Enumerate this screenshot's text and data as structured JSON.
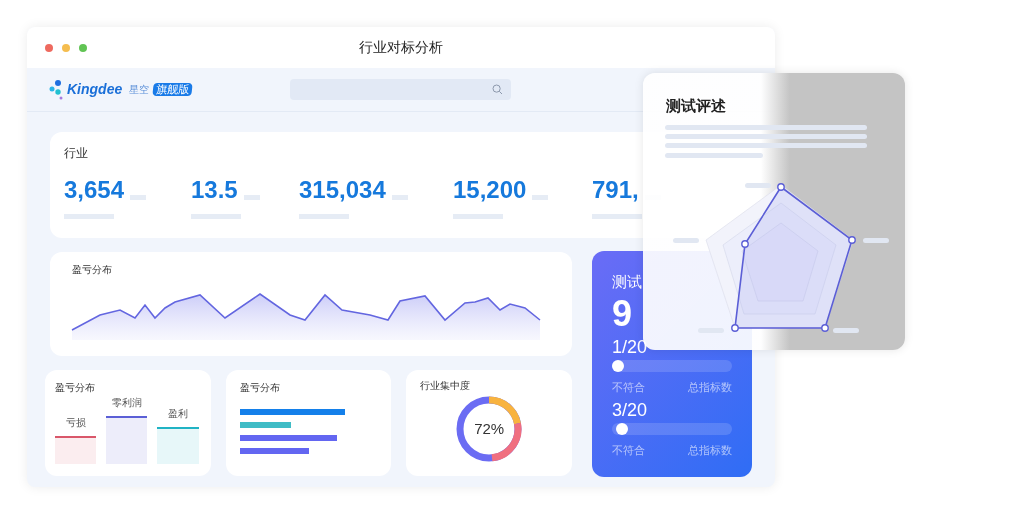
{
  "window": {
    "title": "行业对标分析"
  },
  "header": {
    "logo_text": "Kingdee",
    "logo_cn": "星空",
    "edition_badge": "旗舰版"
  },
  "industry_card": {
    "title": "行业",
    "stats": [
      {
        "value": "3,654"
      },
      {
        "value": "13.5"
      },
      {
        "value": "315,034"
      },
      {
        "value": "15,200"
      },
      {
        "value": "791,"
      }
    ]
  },
  "profit_trend": {
    "title": "盈亏分布"
  },
  "profit_bars": {
    "title": "盈亏分布",
    "bars": [
      {
        "label": "亏损",
        "color": "#d9576a"
      },
      {
        "label": "零利润",
        "color": "#5b5fd6"
      },
      {
        "label": "盈利",
        "color": "#20b3c4"
      }
    ]
  },
  "hbars": {
    "title": "盈亏分布"
  },
  "concentration": {
    "title": "行业集中度",
    "value": "72%"
  },
  "test_card": {
    "title": "测试",
    "score": "9",
    "items": [
      {
        "reading": "1/20",
        "level": 0.05,
        "left_label": "不符合",
        "right_label": "总指标数"
      },
      {
        "reading": "3/20",
        "level": 0.08,
        "left_label": "不符合",
        "right_label": "总指标数"
      }
    ]
  },
  "review_panel": {
    "title": "测试评述"
  }
}
